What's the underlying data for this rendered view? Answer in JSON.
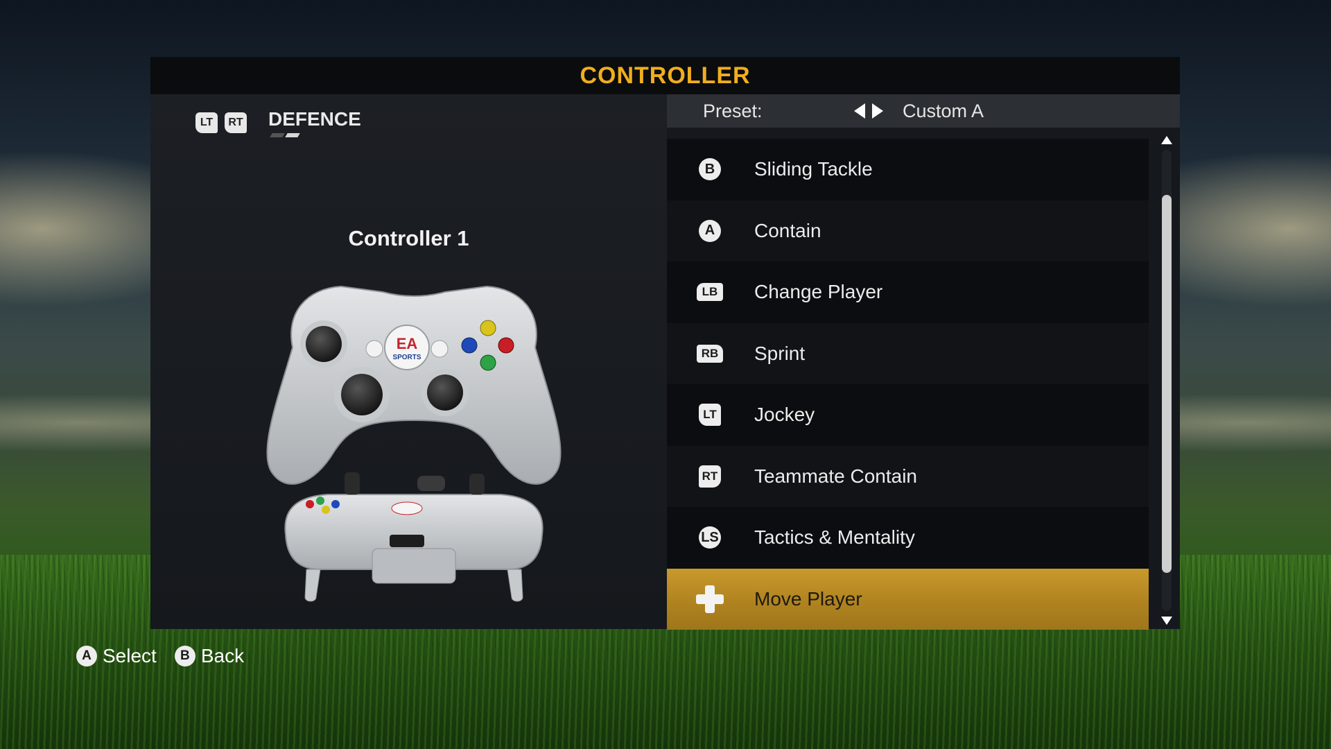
{
  "screen": {
    "title": "CONTROLLER"
  },
  "mode": {
    "label": "DEFENCE",
    "trigger_left": "LT",
    "trigger_right": "RT",
    "page_index": 2,
    "page_count": 2
  },
  "controller": {
    "name": "Controller 1",
    "logo_text": "EA",
    "logo_subtext": "SPORTS"
  },
  "preset": {
    "label": "Preset:",
    "value": "Custom A"
  },
  "actions": [
    {
      "button": "B",
      "button_type": "face",
      "label": "Sliding Tackle"
    },
    {
      "button": "A",
      "button_type": "face",
      "label": "Contain"
    },
    {
      "button": "LB",
      "button_type": "bumper",
      "label": "Change Player"
    },
    {
      "button": "RB",
      "button_type": "bumper",
      "label": "Sprint"
    },
    {
      "button": "LT",
      "button_type": "trigger",
      "label": "Jockey"
    },
    {
      "button": "RT",
      "button_type": "trigger",
      "label": "Teammate Contain"
    },
    {
      "button": "LS",
      "button_type": "face",
      "label": "Tactics & Mentality"
    },
    {
      "button": "dpad-icon",
      "button_type": "dpad",
      "label": "Move Player",
      "selected": true
    }
  ],
  "scroll": {
    "position": 0.35
  },
  "footer": [
    {
      "button": "A",
      "label": "Select"
    },
    {
      "button": "B",
      "label": "Back"
    }
  ],
  "colors": {
    "accent": "#f0ae1e",
    "selected_row": "#b08320"
  }
}
